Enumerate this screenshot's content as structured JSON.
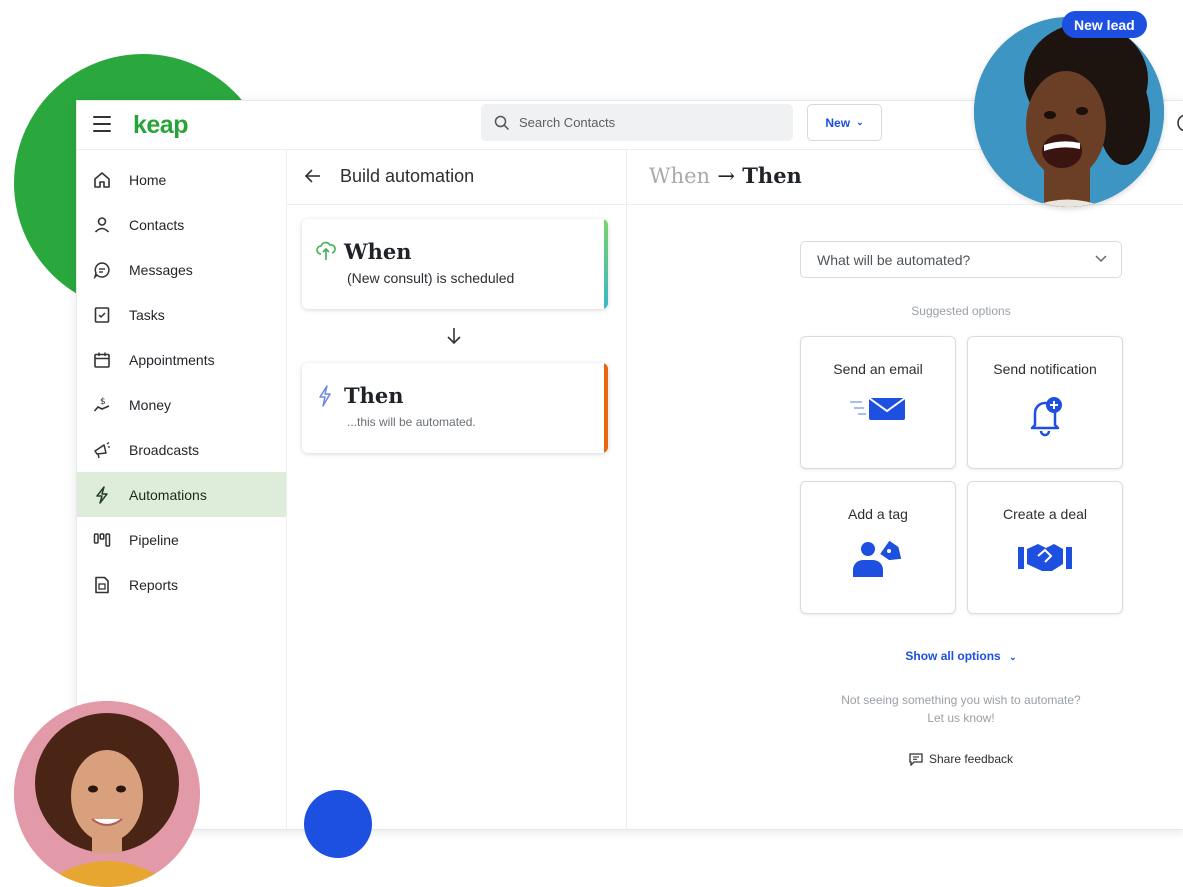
{
  "app": {
    "logo": "keap"
  },
  "header": {
    "search_placeholder": "Search Contacts",
    "new_label": "New",
    "new_chevron": "⌄"
  },
  "sidebar": {
    "items": [
      {
        "label": "Home",
        "icon": "home-icon"
      },
      {
        "label": "Contacts",
        "icon": "person-icon"
      },
      {
        "label": "Messages",
        "icon": "chat-icon"
      },
      {
        "label": "Tasks",
        "icon": "checklist-icon"
      },
      {
        "label": "Appointments",
        "icon": "calendar-icon"
      },
      {
        "label": "Money",
        "icon": "money-hand-icon"
      },
      {
        "label": "Broadcasts",
        "icon": "megaphone-icon"
      },
      {
        "label": "Automations",
        "icon": "lightning-icon",
        "active": true
      },
      {
        "label": "Pipeline",
        "icon": "pipeline-icon"
      },
      {
        "label": "Reports",
        "icon": "report-icon"
      }
    ]
  },
  "builder": {
    "title": "Build automation",
    "when": {
      "title": "When",
      "subtitle": "(New consult) is scheduled",
      "accent": "#3ec6a7"
    },
    "then": {
      "title": "Then",
      "subtitle": "...this will be automated.",
      "accent": "#e8660f"
    }
  },
  "panel": {
    "title_when": "When",
    "title_arrow": "→",
    "title_then": "Then",
    "dropdown_placeholder": "What will be automated?",
    "suggested_label": "Suggested options",
    "options": [
      {
        "label": "Send an email",
        "icon": "email-icon"
      },
      {
        "label": "Send notification",
        "icon": "bell-plus-icon"
      },
      {
        "label": "Add a tag",
        "icon": "person-tag-icon"
      },
      {
        "label": "Create a deal",
        "icon": "handshake-icon"
      }
    ],
    "show_all_label": "Show all options",
    "show_all_chevron": "⌄",
    "not_seeing_line1": "Not seeing something you wish to automate?",
    "not_seeing_line2": "Let us know!",
    "share_label": "Share feedback"
  },
  "overlay": {
    "badge": "New lead"
  },
  "colors": {
    "brand_green": "#28a339",
    "accent_blue": "#1d50e0",
    "active_bg": "#deedd9"
  }
}
